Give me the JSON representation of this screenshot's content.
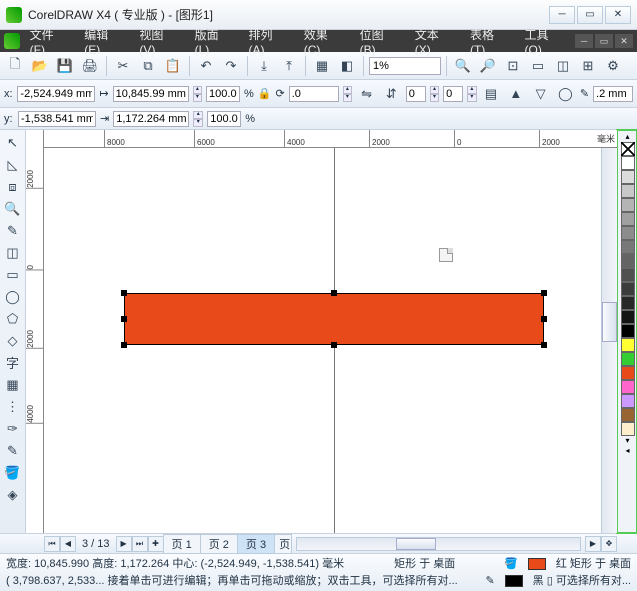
{
  "title": "CorelDRAW X4 ( 专业版 ) - [图形1]",
  "menu": [
    "文件(F)",
    "编辑(E)",
    "视图(V)",
    "版面(L)",
    "排列(A)",
    "效果(C)",
    "位图(B)",
    "文本(X)",
    "表格(T)",
    "工具(O)"
  ],
  "zoom": "1%",
  "coords": {
    "x": "-2,524.949 mm",
    "y": "-1,538.541 mm"
  },
  "size": {
    "w": "10,845.99 mm",
    "h": "1,172.264 mm"
  },
  "scale": {
    "x": "100.0",
    "y": "100.0",
    "unit": "%"
  },
  "rotate": ".0",
  "nudge": ".2 mm",
  "rulerH": {
    "0": "8000",
    "1": "6000",
    "2": "4000",
    "3": "2000",
    "4": "0",
    "5": "2000",
    "unit": "毫米"
  },
  "rulerV": {
    "0": "2000",
    "1": "0",
    "2": "2000",
    "3": "4000"
  },
  "page": {
    "cur": "3",
    "total": "13",
    "info": "3 / 13"
  },
  "tabs": [
    "页 1",
    "页 2",
    "页 3"
  ],
  "tab_more": "页",
  "status1a": "宽度: 10,845.990 高度: 1,172.264 中心: (-2,524.949, -1,538.541) 毫米",
  "status1b": "矩形 于 桌面",
  "status1c": "红   矩形 于 桌面",
  "status2a": "( 3,798.637, 2,533...  接着单击可进行编辑；再单击可拖动或缩放；双击工具，可选择所有对...",
  "status2b": "黑 ▯   可选择所有对...",
  "colors": {
    "fill": "#e84a1a",
    "outline": "#000000"
  },
  "palette": [
    "#ffffff",
    "#dcdcdc",
    "#c8c8c8",
    "#b4b4b4",
    "#a0a0a0",
    "#8c8c8c",
    "#787878",
    "#646464",
    "#505050",
    "#3c3c3c",
    "#282828",
    "#141414",
    "#000000",
    "#ffff33",
    "#33cc33",
    "#e84a1a",
    "#ff66cc",
    "#cc99ff",
    "#996633",
    "#ffeecc"
  ],
  "spinner": "0"
}
